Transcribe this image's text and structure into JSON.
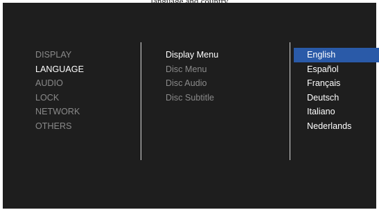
{
  "caption": "language and country",
  "menu": {
    "items": [
      "DISPLAY",
      "LANGUAGE",
      "AUDIO",
      "LOCK",
      "NETWORK",
      "OTHERS"
    ],
    "active_index": 1
  },
  "submenu": {
    "items": [
      "Display Menu",
      "Disc Menu",
      "Disc Audio",
      "Disc Subtitle"
    ],
    "active_index": 0
  },
  "options": {
    "items": [
      "English",
      "Español",
      "Français",
      "Deutsch",
      "Italiano",
      "Nederlands"
    ],
    "selected_index": 0
  },
  "colors": {
    "background": "#1e1e1e",
    "highlight": "#2a5aa8",
    "inactive_text": "#8a8a8a",
    "active_text": "#ffffff"
  }
}
